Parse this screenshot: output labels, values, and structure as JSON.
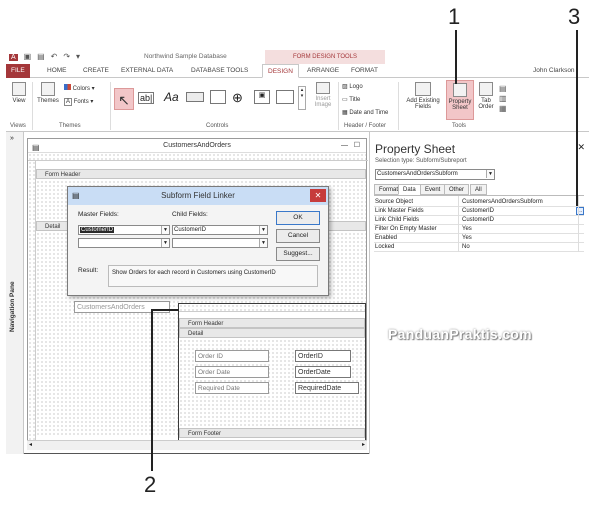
{
  "window": {
    "title": "Northwind Sample Database",
    "contextual_tab": "FORM DESIGN TOOLS",
    "user": "John Clarkson"
  },
  "ribbon_tabs": [
    "FILE",
    "HOME",
    "CREATE",
    "EXTERNAL DATA",
    "DATABASE TOOLS",
    "DESIGN",
    "ARRANGE",
    "FORMAT"
  ],
  "ribbon": {
    "views": {
      "view": "View",
      "group": "Views"
    },
    "themes": {
      "themes": "Themes",
      "colors": "Colors",
      "fonts": "Fonts",
      "group": "Themes"
    },
    "controls": {
      "group": "Controls",
      "insert_image": "Insert Image"
    },
    "header_footer": {
      "logo": "Logo",
      "title": "Title",
      "date_time": "Date and Time",
      "group": "Header / Footer"
    },
    "tools": {
      "add_existing": "Add Existing Fields",
      "property_sheet": "Property Sheet",
      "tab_order": "Tab Order",
      "group": "Tools"
    }
  },
  "nav_pane": {
    "label": "Navigation Pane"
  },
  "form": {
    "title": "CustomersAndOrders",
    "form_header": "Form Header",
    "detail": "Detail",
    "subform_label": "CustomersAndOrders",
    "sub_form_header": "Form Header",
    "sub_detail": "Detail",
    "sub_form_footer": "Form Footer",
    "fields": [
      {
        "label": "Order ID",
        "box": "OrderID"
      },
      {
        "label": "Order Date",
        "box": "OrderDate"
      },
      {
        "label": "Required Date",
        "box": "RequiredDate"
      }
    ]
  },
  "dialog": {
    "title": "Subform Field Linker",
    "master_label": "Master Fields:",
    "child_label": "Child Fields:",
    "master_value": "CustomerID",
    "child_value": "CustomerID",
    "ok": "OK",
    "cancel": "Cancel",
    "suggest": "Suggest...",
    "result_label": "Result:",
    "result_text": "Show Orders for each record in Customers using CustomerID"
  },
  "property_sheet": {
    "title": "Property Sheet",
    "selection_type_label": "Selection type:",
    "selection_type": "Subform/Subreport",
    "object": "CustomersAndOrdersSubform",
    "tabs": [
      "Format",
      "Data",
      "Event",
      "Other",
      "All"
    ],
    "active_tab": "Data",
    "rows": [
      {
        "key": "Source Object",
        "value": "CustomersAndOrdersSubform"
      },
      {
        "key": "Link Master Fields",
        "value": "CustomerID"
      },
      {
        "key": "Link Child Fields",
        "value": "CustomerID"
      },
      {
        "key": "Filter On Empty Master",
        "value": "Yes"
      },
      {
        "key": "Enabled",
        "value": "Yes"
      },
      {
        "key": "Locked",
        "value": "No"
      }
    ]
  },
  "callouts": [
    "1",
    "2",
    "3"
  ],
  "watermark": "PanduanPraktis.com",
  "colors": {
    "accent": "#a4373a",
    "highlight": "#f2c6c8",
    "dialog_title": "#c9ddf5"
  }
}
